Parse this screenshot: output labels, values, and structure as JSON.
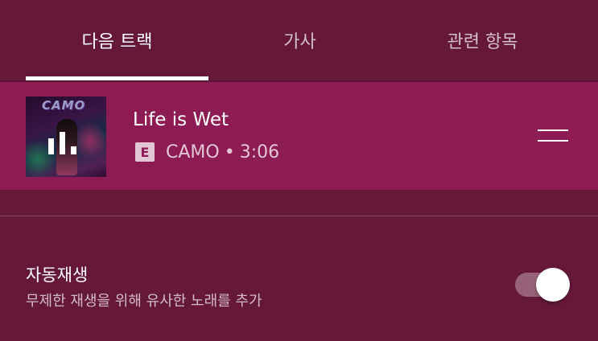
{
  "tabs": [
    {
      "label": "다음 트랙",
      "active": true
    },
    {
      "label": "가사",
      "active": false
    },
    {
      "label": "관련 항목",
      "active": false
    }
  ],
  "queue": {
    "current": {
      "title": "Life is Wet",
      "explicit_badge": "E",
      "artist": "CAMO",
      "separator": "•",
      "duration": "3:06",
      "art_logo_text": "CAMO",
      "art_icon": "equalizer-playing-icon"
    }
  },
  "autoplay": {
    "title": "자동재생",
    "description": "무제한 재생을 위해 유사한 노래를 추가",
    "enabled": true
  },
  "icons": {
    "drag": "drag-handle-icon",
    "playing": "equalizer-icon"
  },
  "colors": {
    "background": "#661839",
    "now_playing_row": "#8e1c54",
    "accent": "#ffffff"
  }
}
